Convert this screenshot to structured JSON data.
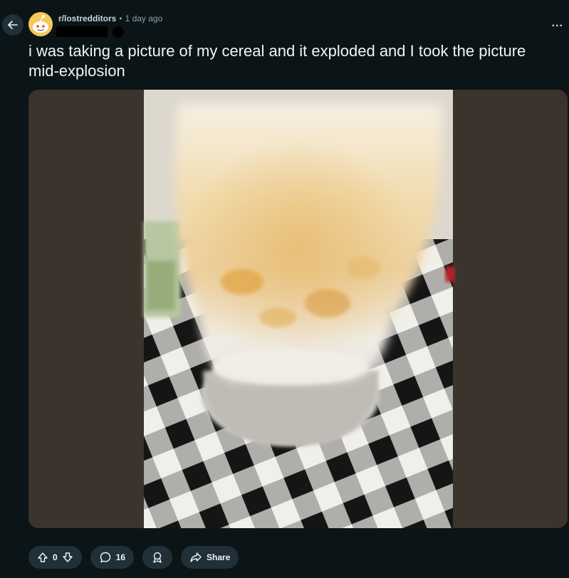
{
  "header": {
    "subreddit": "r/lostredditors",
    "separator": "•",
    "age": "1 day ago",
    "more_label": "..."
  },
  "post": {
    "title": "i was taking a picture of my cereal and it exploded and I took the picture mid-explosion"
  },
  "actions": {
    "score": "0",
    "comments": "16",
    "share_label": "Share"
  },
  "icons": {
    "back": "arrow-left-icon",
    "avatar": "snoo-icon",
    "upvote": "arrow-up-icon",
    "downvote": "arrow-down-icon",
    "comment": "comment-bubble-icon",
    "award": "award-icon",
    "share": "share-arrow-icon"
  },
  "colors": {
    "background": "#0b1416",
    "button_bg": "#1f3038",
    "subreddit_text": "#c9d6dc",
    "meta_text": "#8ba2ad"
  }
}
